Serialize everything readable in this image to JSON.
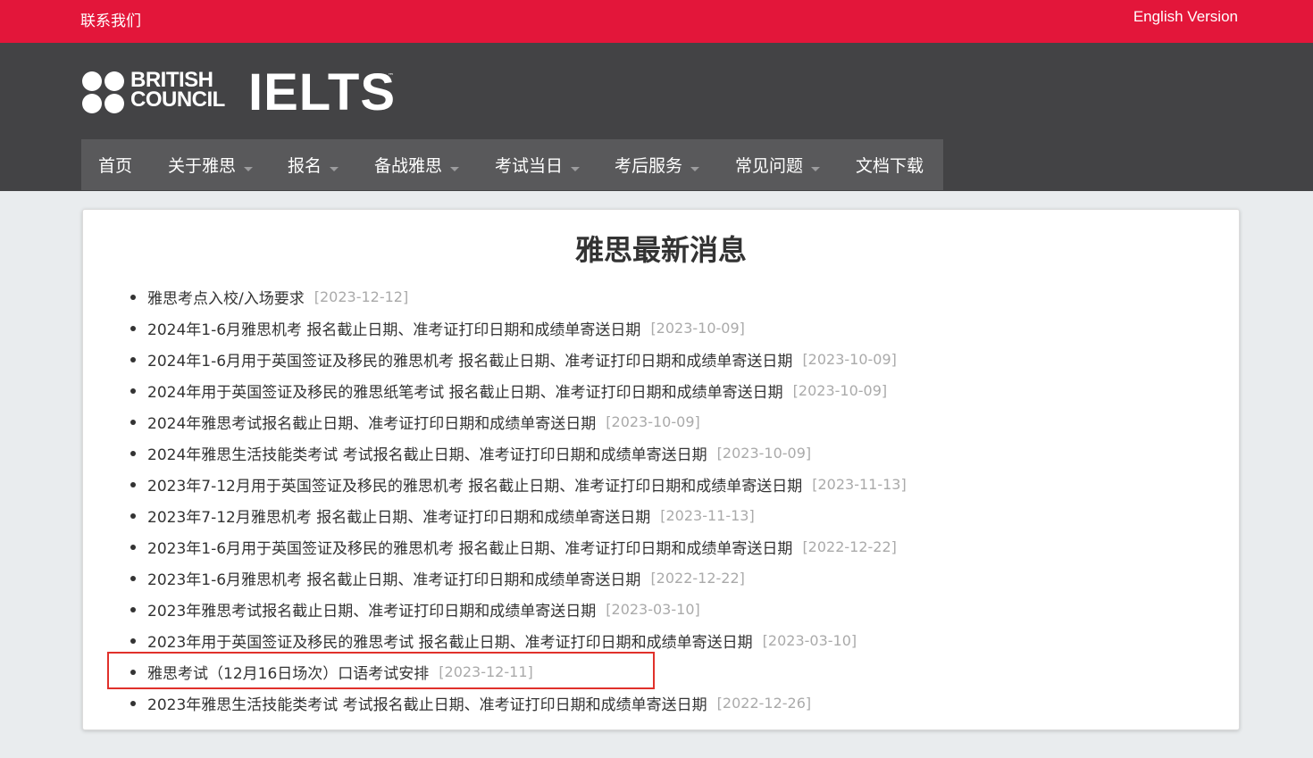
{
  "topbar": {
    "contact_label": "联系我们",
    "english_label": "English Version",
    "bg_color": "#e3163a"
  },
  "logo": {
    "bc_line1": "BRITISH",
    "bc_line2": "COUNCIL",
    "ielts": "IELTS",
    "tm": "™"
  },
  "nav": {
    "items": [
      {
        "label": "首页",
        "has_dropdown": false
      },
      {
        "label": "关于雅思",
        "has_dropdown": true
      },
      {
        "label": "报名",
        "has_dropdown": true
      },
      {
        "label": "备战雅思",
        "has_dropdown": true
      },
      {
        "label": "考试当日",
        "has_dropdown": true
      },
      {
        "label": "考后服务",
        "has_dropdown": true
      },
      {
        "label": "常见问题",
        "has_dropdown": true
      },
      {
        "label": "文档下载",
        "has_dropdown": false
      }
    ]
  },
  "main": {
    "title": "雅思最新消息",
    "news": [
      {
        "title": "雅思考点入校/入场要求",
        "date": "[2023-12-12]"
      },
      {
        "title": "2024年1-6月雅思机考 报名截止日期、准考证打印日期和成绩单寄送日期",
        "date": "[2023-10-09]"
      },
      {
        "title": "2024年1-6月用于英国签证及移民的雅思机考 报名截止日期、准考证打印日期和成绩单寄送日期",
        "date": "[2023-10-09]"
      },
      {
        "title": "2024年用于英国签证及移民的雅思纸笔考试 报名截止日期、准考证打印日期和成绩单寄送日期",
        "date": "[2023-10-09]"
      },
      {
        "title": "2024年雅思考试报名截止日期、准考证打印日期和成绩单寄送日期",
        "date": "[2023-10-09]"
      },
      {
        "title": "2024年雅思生活技能类考试 考试报名截止日期、准考证打印日期和成绩单寄送日期",
        "date": "[2023-10-09]"
      },
      {
        "title": "2023年7-12月用于英国签证及移民的雅思机考 报名截止日期、准考证打印日期和成绩单寄送日期",
        "date": "[2023-11-13]"
      },
      {
        "title": "2023年7-12月雅思机考 报名截止日期、准考证打印日期和成绩单寄送日期",
        "date": "[2023-11-13]"
      },
      {
        "title": "2023年1-6月用于英国签证及移民的雅思机考 报名截止日期、准考证打印日期和成绩单寄送日期",
        "date": "[2022-12-22]"
      },
      {
        "title": "2023年1-6月雅思机考 报名截止日期、准考证打印日期和成绩单寄送日期",
        "date": "[2022-12-22]"
      },
      {
        "title": "2023年雅思考试报名截止日期、准考证打印日期和成绩单寄送日期",
        "date": "[2023-03-10]"
      },
      {
        "title": "2023年用于英国签证及移民的雅思考试 报名截止日期、准考证打印日期和成绩单寄送日期",
        "date": "[2023-03-10]"
      },
      {
        "title": "雅思考试（12月16日场次）口语考试安排",
        "date": "[2023-12-11]"
      },
      {
        "title": "2023年雅思生活技能类考试 考试报名截止日期、准考证打印日期和成绩单寄送日期",
        "date": "[2022-12-26]"
      }
    ]
  },
  "highlight_color": "#e0312b"
}
